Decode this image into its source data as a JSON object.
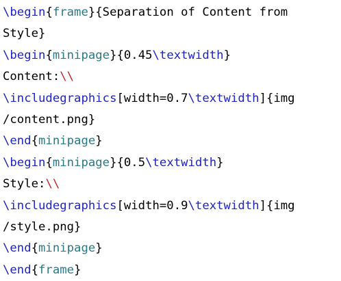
{
  "colors": {
    "background": "#ffffff",
    "command": "#1f24c4",
    "environment": "#2a7a86",
    "linebreak": "#c62828",
    "text": "#000000"
  },
  "lines": [
    [
      {
        "type": "cmd",
        "text": "\\begin"
      },
      {
        "type": "text",
        "text": "{"
      },
      {
        "type": "env",
        "text": "frame"
      },
      {
        "type": "text",
        "text": "}{Separation of Content from"
      }
    ],
    [
      {
        "type": "text",
        "text": "Style}"
      }
    ],
    [
      {
        "type": "cmd",
        "text": "\\begin"
      },
      {
        "type": "text",
        "text": "{"
      },
      {
        "type": "env",
        "text": "minipage"
      },
      {
        "type": "text",
        "text": "}{0.45"
      },
      {
        "type": "cmd",
        "text": "\\textwidth"
      },
      {
        "type": "text",
        "text": "}"
      }
    ],
    [
      {
        "type": "text",
        "text": "Content:"
      },
      {
        "type": "break",
        "text": "\\\\"
      }
    ],
    [
      {
        "type": "cmd",
        "text": "\\includegraphics"
      },
      {
        "type": "text",
        "text": "[width=0.7"
      },
      {
        "type": "cmd",
        "text": "\\textwidth"
      },
      {
        "type": "text",
        "text": "]{img"
      }
    ],
    [
      {
        "type": "text",
        "text": "/content.png}"
      }
    ],
    [
      {
        "type": "cmd",
        "text": "\\end"
      },
      {
        "type": "text",
        "text": "{"
      },
      {
        "type": "env",
        "text": "minipage"
      },
      {
        "type": "text",
        "text": "}"
      }
    ],
    [
      {
        "type": "cmd",
        "text": "\\begin"
      },
      {
        "type": "text",
        "text": "{"
      },
      {
        "type": "env",
        "text": "minipage"
      },
      {
        "type": "text",
        "text": "}{0.5"
      },
      {
        "type": "cmd",
        "text": "\\textwidth"
      },
      {
        "type": "text",
        "text": "}"
      }
    ],
    [
      {
        "type": "text",
        "text": "Style:"
      },
      {
        "type": "break",
        "text": "\\\\"
      }
    ],
    [
      {
        "type": "cmd",
        "text": "\\includegraphics"
      },
      {
        "type": "text",
        "text": "[width=0.9"
      },
      {
        "type": "cmd",
        "text": "\\textwidth"
      },
      {
        "type": "text",
        "text": "]{img"
      }
    ],
    [
      {
        "type": "text",
        "text": "/style.png}"
      }
    ],
    [
      {
        "type": "cmd",
        "text": "\\end"
      },
      {
        "type": "text",
        "text": "{"
      },
      {
        "type": "env",
        "text": "minipage"
      },
      {
        "type": "text",
        "text": "}"
      }
    ],
    [
      {
        "type": "cmd",
        "text": "\\end"
      },
      {
        "type": "text",
        "text": "{"
      },
      {
        "type": "env",
        "text": "frame"
      },
      {
        "type": "text",
        "text": "}"
      }
    ]
  ]
}
